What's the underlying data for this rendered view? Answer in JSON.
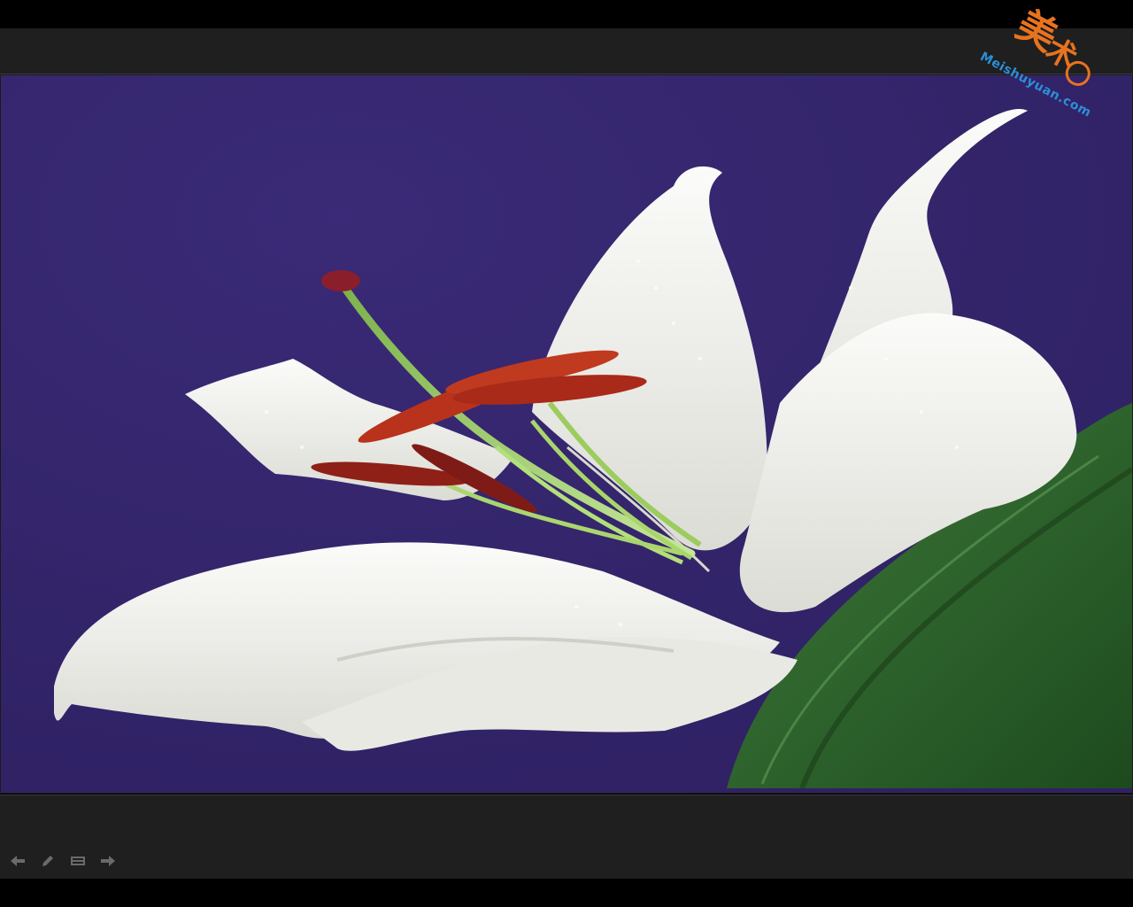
{
  "viewer": {
    "photo_name": "white-lily-on-purple",
    "colors": {
      "background": "#3b2a78",
      "bar": "#1f1f1f",
      "petal": "#f2f2ee",
      "stem": "#9ccc5e",
      "anther": "#b8321c",
      "leaf": "#2f6b2e"
    }
  },
  "watermark": {
    "text_latin": "Meishuyuan.com",
    "text_cn": "美术园"
  },
  "toolbar": {
    "items": [
      {
        "name": "previous",
        "icon": "arrow-left-icon"
      },
      {
        "name": "edit",
        "icon": "pencil-icon"
      },
      {
        "name": "slideshow",
        "icon": "filmstrip-icon"
      },
      {
        "name": "next",
        "icon": "arrow-right-icon"
      }
    ]
  }
}
